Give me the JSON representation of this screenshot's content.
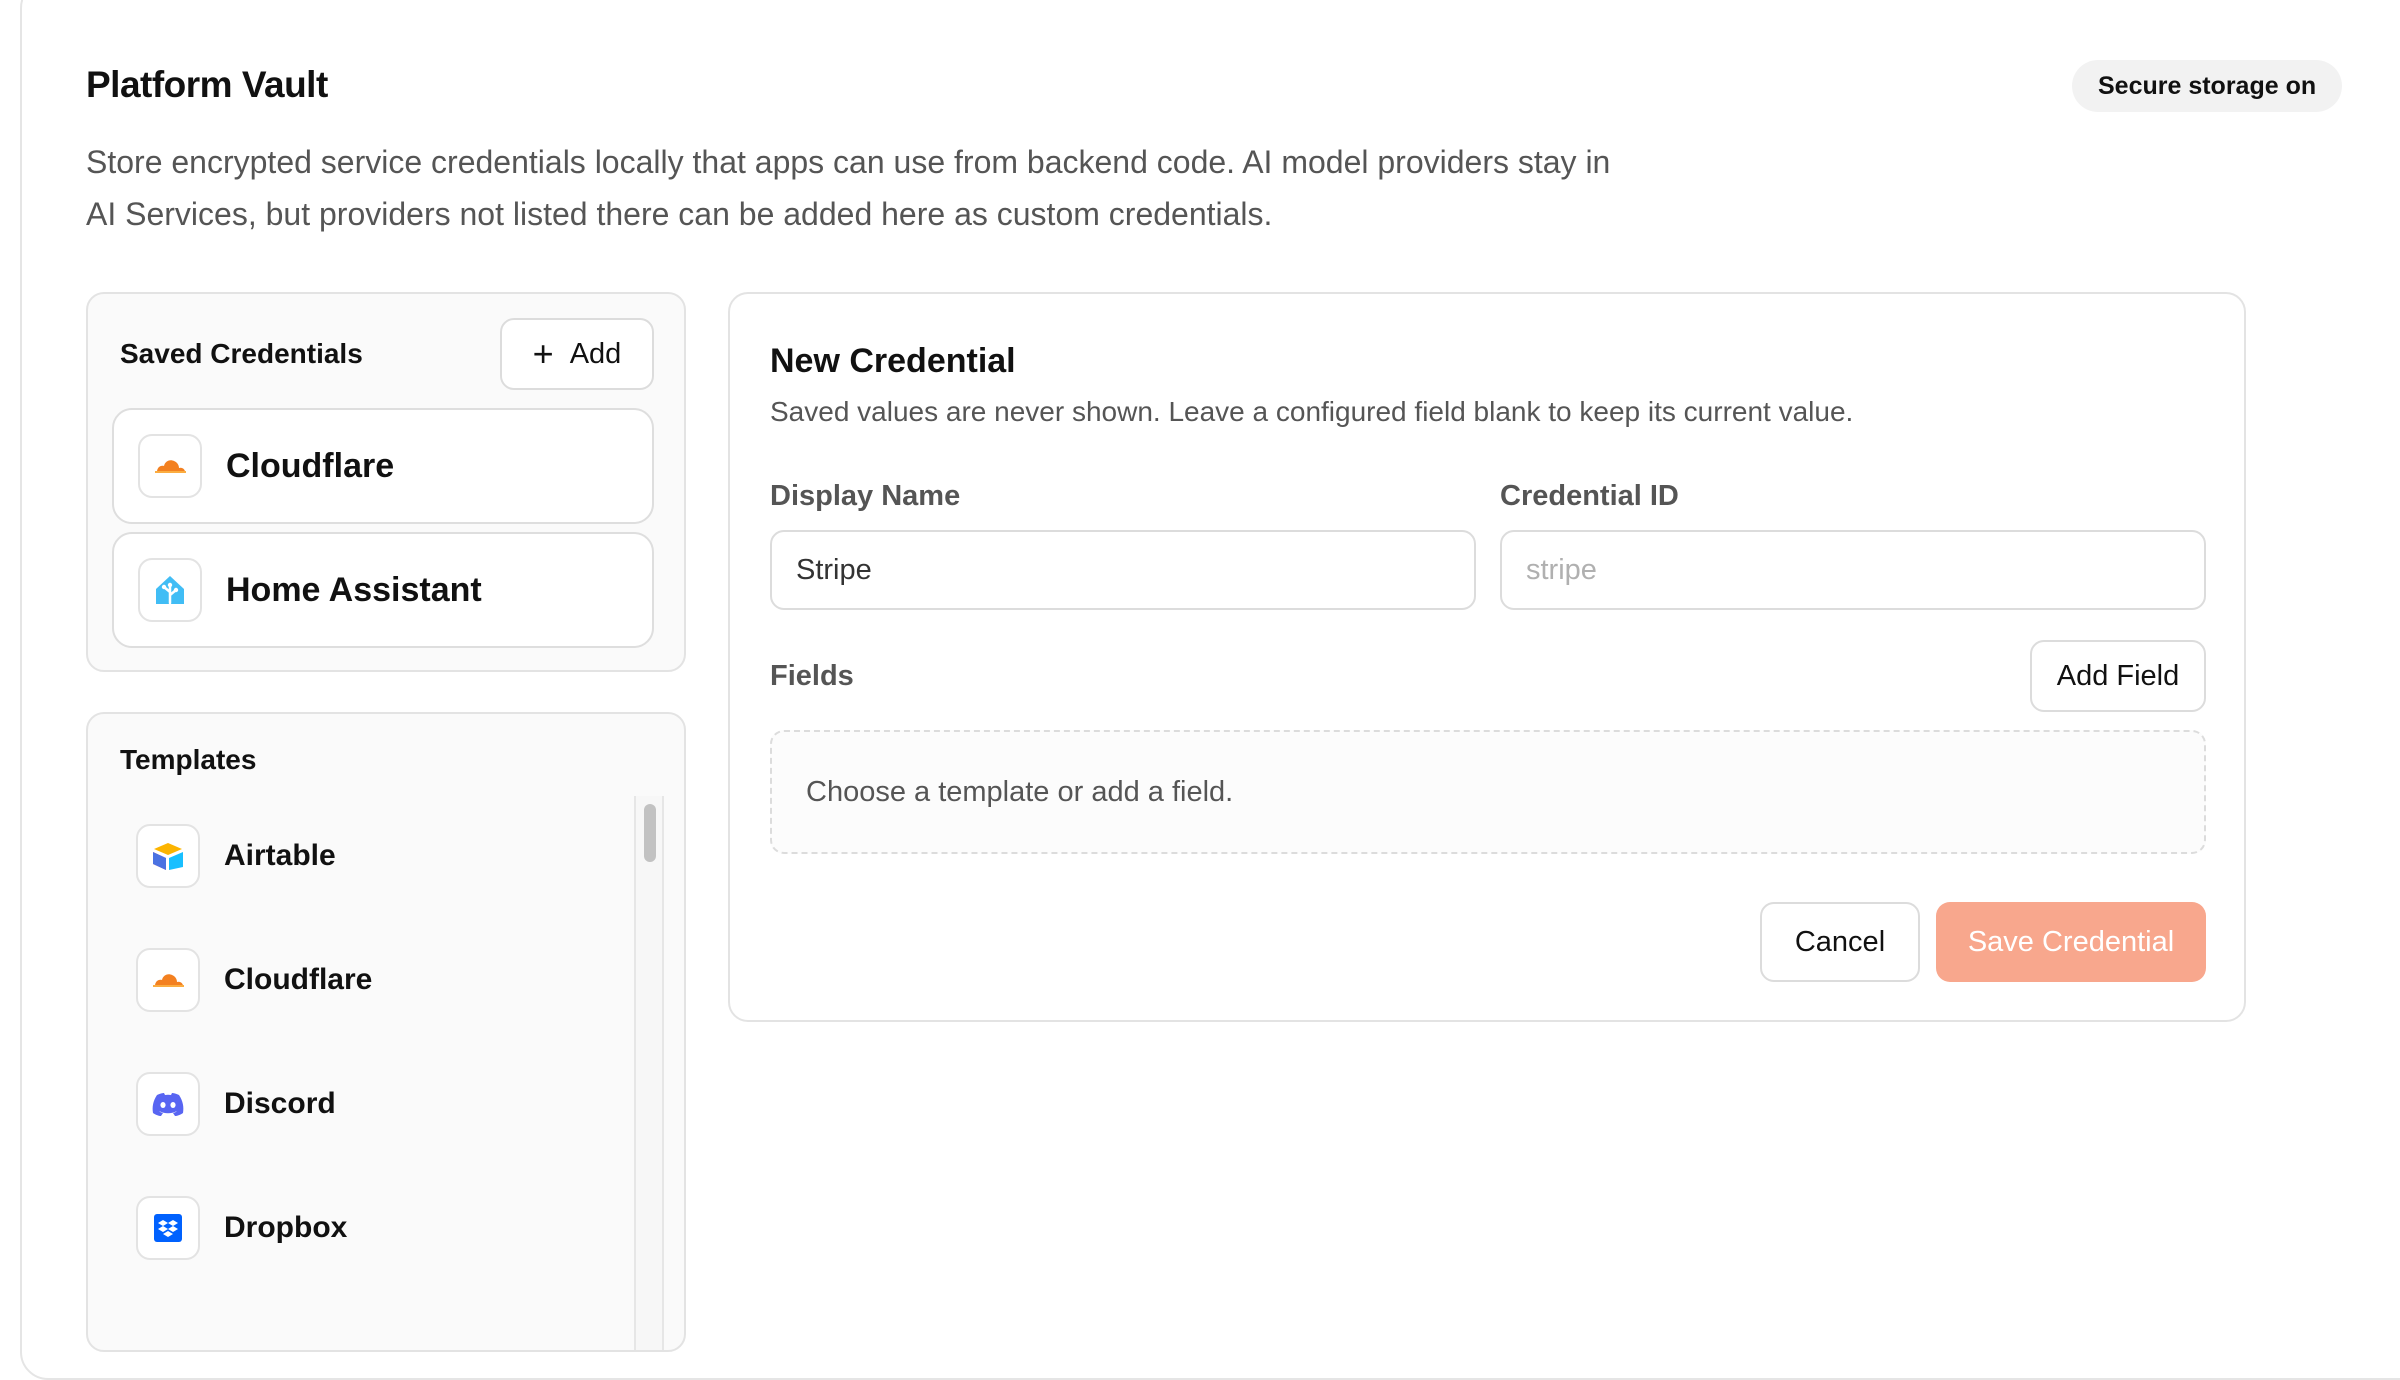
{
  "header": {
    "title": "Platform Vault",
    "status_badge": "Secure storage on",
    "description": "Store encrypted service credentials locally that apps can use from backend code. AI model providers stay in AI Services, but providers not listed there can be added here as custom credentials."
  },
  "saved_credentials": {
    "title": "Saved Credentials",
    "add_label": "Add",
    "items": [
      {
        "label": "Cloudflare",
        "icon": "cloudflare-logo-icon"
      },
      {
        "label": "Home Assistant",
        "icon": "home-assistant-logo-icon"
      }
    ]
  },
  "templates": {
    "title": "Templates",
    "items": [
      {
        "label": "Airtable",
        "icon": "airtable-logo-icon"
      },
      {
        "label": "Cloudflare",
        "icon": "cloudflare-logo-icon"
      },
      {
        "label": "Discord",
        "icon": "discord-logo-icon"
      },
      {
        "label": "Dropbox",
        "icon": "dropbox-logo-icon"
      }
    ]
  },
  "form": {
    "title": "New Credential",
    "description": "Saved values are never shown. Leave a configured field blank to keep its current value.",
    "display_name_label": "Display Name",
    "display_name_value": "Stripe",
    "credential_id_label": "Credential ID",
    "credential_id_placeholder": "stripe",
    "fields_label": "Fields",
    "add_field_label": "Add Field",
    "empty_fields_text": "Choose a template or add a field.",
    "cancel_label": "Cancel",
    "save_label": "Save Credential"
  },
  "colors": {
    "save_button_disabled": "#f8a78d",
    "cloudflare_orange": "#f38020",
    "home_assistant_blue": "#41bdf5",
    "discord_blurple": "#5865f2",
    "dropbox_blue": "#0061fe"
  }
}
